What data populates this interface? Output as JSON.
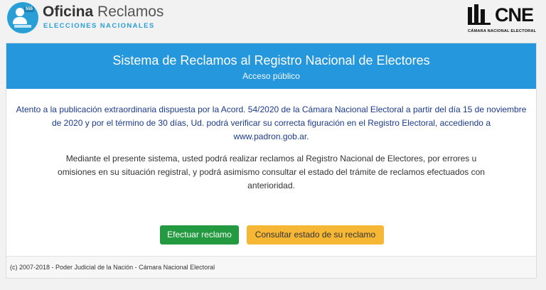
{
  "header": {
    "logo_left": {
      "icon": "ballot-person-icon",
      "tag": "555",
      "word1": "Oficina",
      "word2": "Reclamos",
      "subtitle": "ELECCIONES NACIONALES"
    },
    "logo_right": {
      "icon": "cne-columns-icon",
      "text": "CNE",
      "subtitle": "CÁMARA NACIONAL ELECTORAL"
    }
  },
  "card": {
    "title": "Sistema de Reclamos al Registro Nacional de Electores",
    "subtitle": "Acceso público",
    "notice_before_link": "Atento a la publicación extraordinaria dispuesta por la Acord. 54/2020 de la Cámara Nacional Electoral a partir del día 15 de noviembre de 2020 y por el término de 30 días, Ud. podrá verificar su correcta figuración en el Registro Electoral, accediendo a ",
    "notice_link": "www.padron.gob.ar",
    "notice_after_link": ".",
    "description": "Mediante el presente sistema, usted podrá realizar reclamos al Registro Nacional de Electores, por errores u omisiones en su situación registral, y podrá asimismo consultar el estado del trámite de reclamos efectuados con anterioridad.",
    "buttons": {
      "primary": "Efectuar reclamo",
      "secondary": "Consultar estado de su reclamo"
    },
    "footer": "(c) 2007-2018 - Poder Judicial de la Nación - Cámara Nacional Electoral"
  },
  "colors": {
    "header_blue": "#2497dd",
    "logo_blue": "#2a9fd6",
    "notice_text": "#1b3a8c",
    "primary_button": "#239a3f",
    "secondary_button": "#f6b734"
  }
}
